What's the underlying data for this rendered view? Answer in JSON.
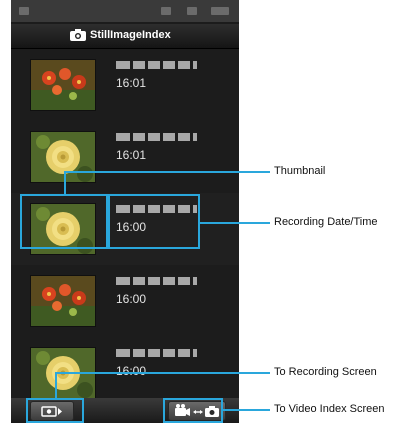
{
  "app": {
    "title": "StillImageIndex",
    "title_icon": "camera-icon"
  },
  "items": [
    {
      "thumbnail": "red-flowers",
      "time": "16:01",
      "selected": false
    },
    {
      "thumbnail": "yellow-rose",
      "time": "16:01",
      "selected": false
    },
    {
      "thumbnail": "yellow-rose",
      "time": "16:00",
      "selected": true
    },
    {
      "thumbnail": "red-flowers",
      "time": "16:00",
      "selected": false
    },
    {
      "thumbnail": "yellow-rose",
      "time": "16:00",
      "selected": false
    }
  ],
  "bottom_bar": {
    "record_button_icon": "record-screen-icon",
    "video_index_button_icon": "video-camera-toggle-icon"
  },
  "annotations": {
    "thumbnail": "Thumbnail",
    "recording_datetime": "Recording Date/Time",
    "to_recording_screen": "To Recording Screen",
    "to_video_index_screen": "To Video Index Screen"
  },
  "colors": {
    "annotation": "#2aa7dc",
    "screen_background": "#1c1c1c",
    "text": "#e4e4e4"
  }
}
